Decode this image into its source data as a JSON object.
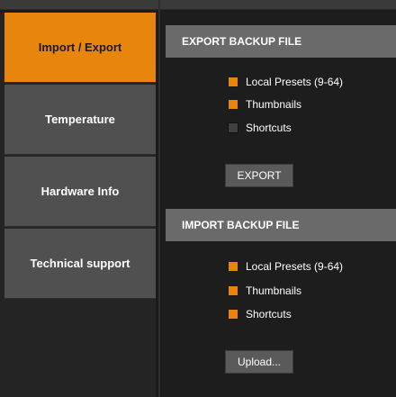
{
  "sidebar": {
    "items": [
      {
        "label": "Import / Export",
        "active": true
      },
      {
        "label": "Temperature",
        "active": false
      },
      {
        "label": "Hardware Info",
        "active": false
      },
      {
        "label": "Technical support",
        "active": false
      }
    ]
  },
  "export_section": {
    "title": "EXPORT BACKUP FILE",
    "options": [
      {
        "label": "Local Presets (9-64)",
        "checked": true
      },
      {
        "label": "Thumbnails",
        "checked": true
      },
      {
        "label": "Shortcuts",
        "checked": false
      }
    ],
    "button_label": "EXPORT"
  },
  "import_section": {
    "title": "IMPORT BACKUP FILE",
    "options": [
      {
        "label": "Local Presets (9-64)",
        "checked": true
      },
      {
        "label": "Thumbnails",
        "checked": true
      },
      {
        "label": "Shortcuts",
        "checked": true
      }
    ],
    "button_label": "Upload..."
  },
  "colors": {
    "accent": "#e8850c",
    "panel": "#505050",
    "header": "#6a6a6a",
    "background": "#1d1d1d"
  }
}
